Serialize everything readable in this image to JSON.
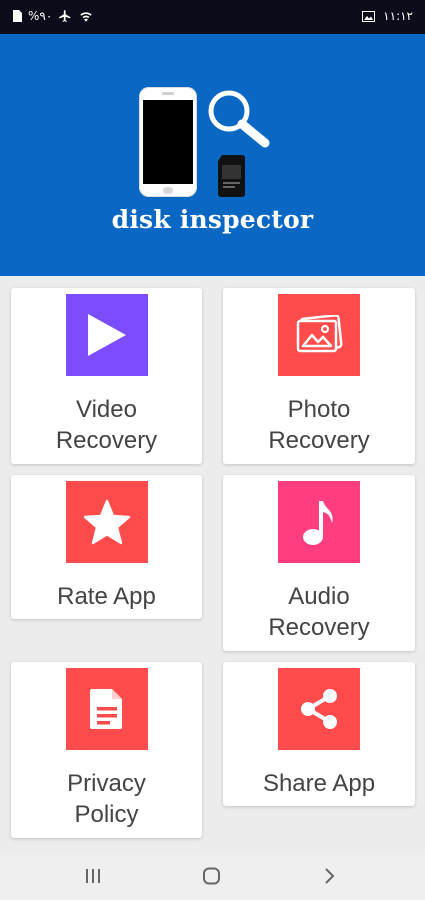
{
  "status_bar": {
    "left_text": "%٩٠",
    "time": "١١:١٢",
    "icons": [
      "sim-icon",
      "airplane-icon",
      "wifi-icon",
      "image-notification-icon"
    ]
  },
  "header": {
    "app_name": "disk inspector",
    "background_color": "#0a67c3"
  },
  "cards": [
    {
      "label_line1": "Video",
      "label_line2": "Recovery",
      "icon": "play-icon",
      "tile_color": "#7b4dff"
    },
    {
      "label_line1": "Photo",
      "label_line2": "Recovery",
      "icon": "photo-icon",
      "tile_color": "#ff4b4b"
    },
    {
      "label_line1": "Rate App",
      "icon": "star-icon",
      "tile_color": "#ff4b4b"
    },
    {
      "label_line1": "Audio",
      "label_line2": "Recovery",
      "icon": "music-note-icon",
      "tile_color": "#ff3d7f"
    },
    {
      "label_line1": "Privacy",
      "label_line2": "Policy",
      "icon": "document-icon",
      "tile_color": "#ff4b4b"
    },
    {
      "label_line1": "Share App",
      "icon": "share-icon",
      "tile_color": "#ff4b4b"
    }
  ],
  "nav_bar": {
    "buttons": [
      "recents-icon",
      "home-icon",
      "back-icon"
    ]
  }
}
